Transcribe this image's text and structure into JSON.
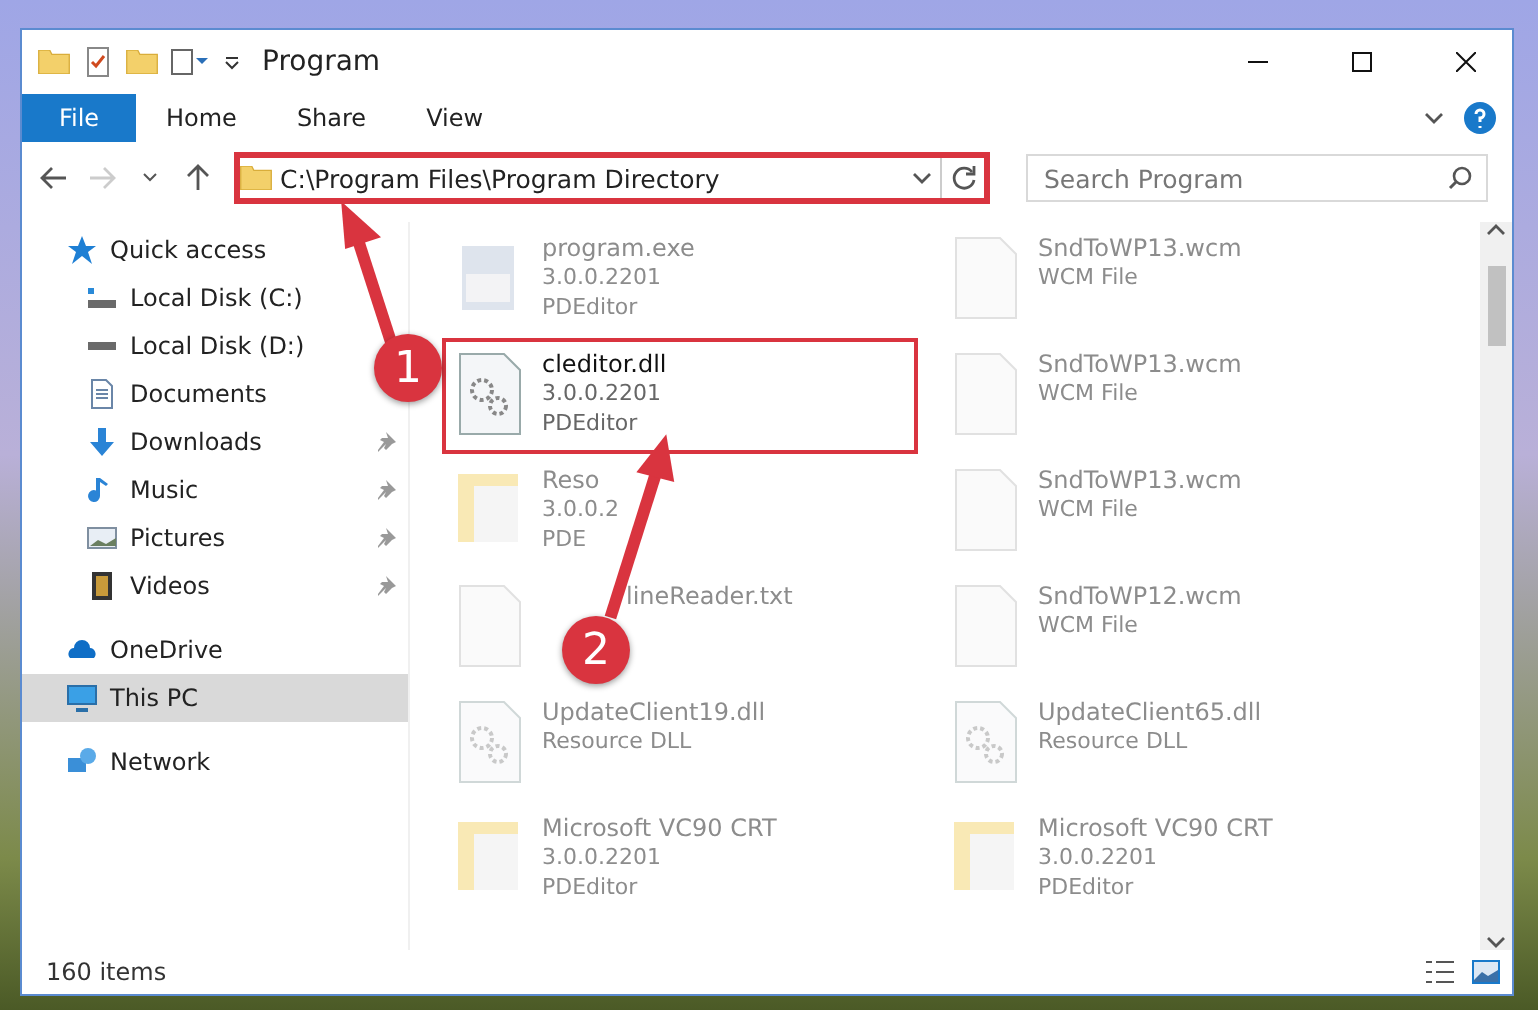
{
  "window": {
    "title": "Program"
  },
  "ribbon_tabs": [
    {
      "label": "File",
      "selected": true
    },
    {
      "label": "Home",
      "selected": false
    },
    {
      "label": "Share",
      "selected": false
    },
    {
      "label": "View",
      "selected": false
    }
  ],
  "address": {
    "path": "C:\\Program Files\\Program Directory",
    "highlighted": true
  },
  "search": {
    "placeholder": "Search Program"
  },
  "nav": [
    {
      "label": "Quick access",
      "kind": "quick",
      "pinned": false,
      "selected": false
    },
    {
      "label": "Local Disk (C:)",
      "kind": "sysdisk",
      "pinned": false,
      "selected": false
    },
    {
      "label": "Local Disk (D:)",
      "kind": "disk",
      "pinned": false,
      "selected": false
    },
    {
      "label": "Documents",
      "kind": "documents",
      "pinned": false,
      "selected": false
    },
    {
      "label": "Downloads",
      "kind": "downloads",
      "pinned": true,
      "selected": false
    },
    {
      "label": "Music",
      "kind": "music",
      "pinned": true,
      "selected": false
    },
    {
      "label": "Pictures",
      "kind": "pictures",
      "pinned": true,
      "selected": false
    },
    {
      "label": "Videos",
      "kind": "videos",
      "pinned": true,
      "selected": false
    },
    {
      "label": "OneDrive",
      "kind": "cloud",
      "pinned": false,
      "selected": false
    },
    {
      "label": "This PC",
      "kind": "pc",
      "pinned": false,
      "selected": true
    },
    {
      "label": "Network",
      "kind": "network",
      "pinned": false,
      "selected": false
    }
  ],
  "files": [
    {
      "name": "program.exe",
      "details": [
        "3.0.0.2201",
        "PDEditor"
      ],
      "kind": "exe",
      "faded": true,
      "highlighted": false
    },
    {
      "name": "SndToWP13.wcm",
      "details": [
        "WCM File"
      ],
      "kind": "doc",
      "faded": true,
      "highlighted": false
    },
    {
      "name": "cleditor.dll",
      "details": [
        "3.0.0.2201",
        "PDEditor"
      ],
      "kind": "dll",
      "faded": false,
      "highlighted": true
    },
    {
      "name": "SndToWP13.wcm",
      "details": [
        "WCM File"
      ],
      "kind": "doc",
      "faded": true,
      "highlighted": false
    },
    {
      "name": "Reso",
      "details": [
        "3.0.0.2",
        "PDE"
      ],
      "kind": "folder",
      "faded": true,
      "highlighted": false
    },
    {
      "name": "SndToWP13.wcm",
      "details": [
        "WCM File"
      ],
      "kind": "doc",
      "faded": true,
      "highlighted": false
    },
    {
      "name": "lineReader.txt",
      "kind": "doc",
      "faded": true,
      "highlighted": false,
      "cut_start": true
    },
    {
      "name": "SndToWP12.wcm",
      "details": [
        "WCM File"
      ],
      "kind": "doc",
      "faded": true,
      "highlighted": false
    },
    {
      "name": "UpdateClient19.dll",
      "details": [
        "Resource DLL"
      ],
      "kind": "dll",
      "faded": true,
      "highlighted": false
    },
    {
      "name": "UpdateClient65.dll",
      "details": [
        "Resource DLL"
      ],
      "kind": "dll",
      "faded": true,
      "highlighted": false
    },
    {
      "name": "Microsoft VC90 CRT",
      "details": [
        "3.0.0.2201",
        "PDEditor"
      ],
      "kind": "folder",
      "faded": true,
      "highlighted": false
    },
    {
      "name": "Microsoft VC90 CRT",
      "details": [
        "3.0.0.2201",
        "PDEditor"
      ],
      "kind": "folder",
      "faded": true,
      "highlighted": false
    }
  ],
  "status_bar": {
    "count": "160 items"
  },
  "annotations": [
    {
      "label": "1"
    },
    {
      "label": "2"
    }
  ]
}
